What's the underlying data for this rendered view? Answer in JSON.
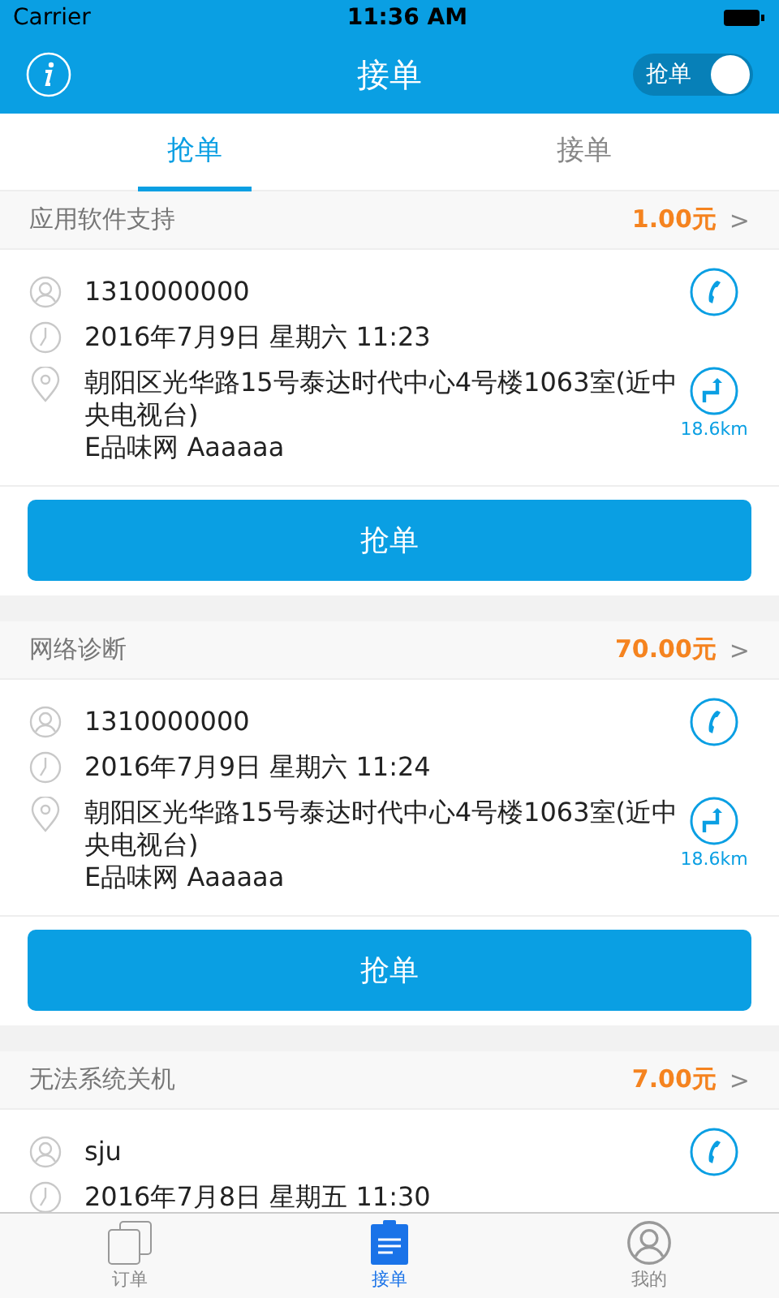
{
  "status_bar": {
    "carrier": "Carrier",
    "time": "11:36 AM"
  },
  "nav": {
    "title": "接单",
    "toggle": {
      "label": "抢单",
      "on": true
    }
  },
  "tabs": [
    {
      "label": "抢单",
      "selected": true
    },
    {
      "label": "接单",
      "selected": false
    }
  ],
  "orders": [
    {
      "title": "应用软件支持",
      "price": "1.00元",
      "arrow": ">",
      "contact": "1310000000",
      "time": "2016年7月9日 星期六 11:23",
      "address": "朝阳区光华路15号泰达时代中心4号楼1063室(近中央电视台)",
      "shop": "E品味网 Aaaaaa",
      "distance": "18.6km",
      "button": "抢单"
    },
    {
      "title": "网络诊断",
      "price": "70.00元",
      "arrow": ">",
      "contact": "1310000000",
      "time": "2016年7月9日 星期六 11:24",
      "address": "朝阳区光华路15号泰达时代中心4号楼1063室(近中央电视台)",
      "shop": "E品味网 Aaaaaa",
      "distance": "18.6km",
      "button": "抢单"
    },
    {
      "title": "无法系统关机",
      "price": "7.00元",
      "arrow": ">",
      "contact": "sju",
      "time": "2016年7月8日 星期五 11:30"
    }
  ],
  "tab_bar": [
    {
      "label": "订单",
      "kind": "docs",
      "selected": false
    },
    {
      "label": "接单",
      "kind": "clipboard",
      "selected": true
    },
    {
      "label": "我的",
      "kind": "person",
      "selected": false
    }
  ]
}
